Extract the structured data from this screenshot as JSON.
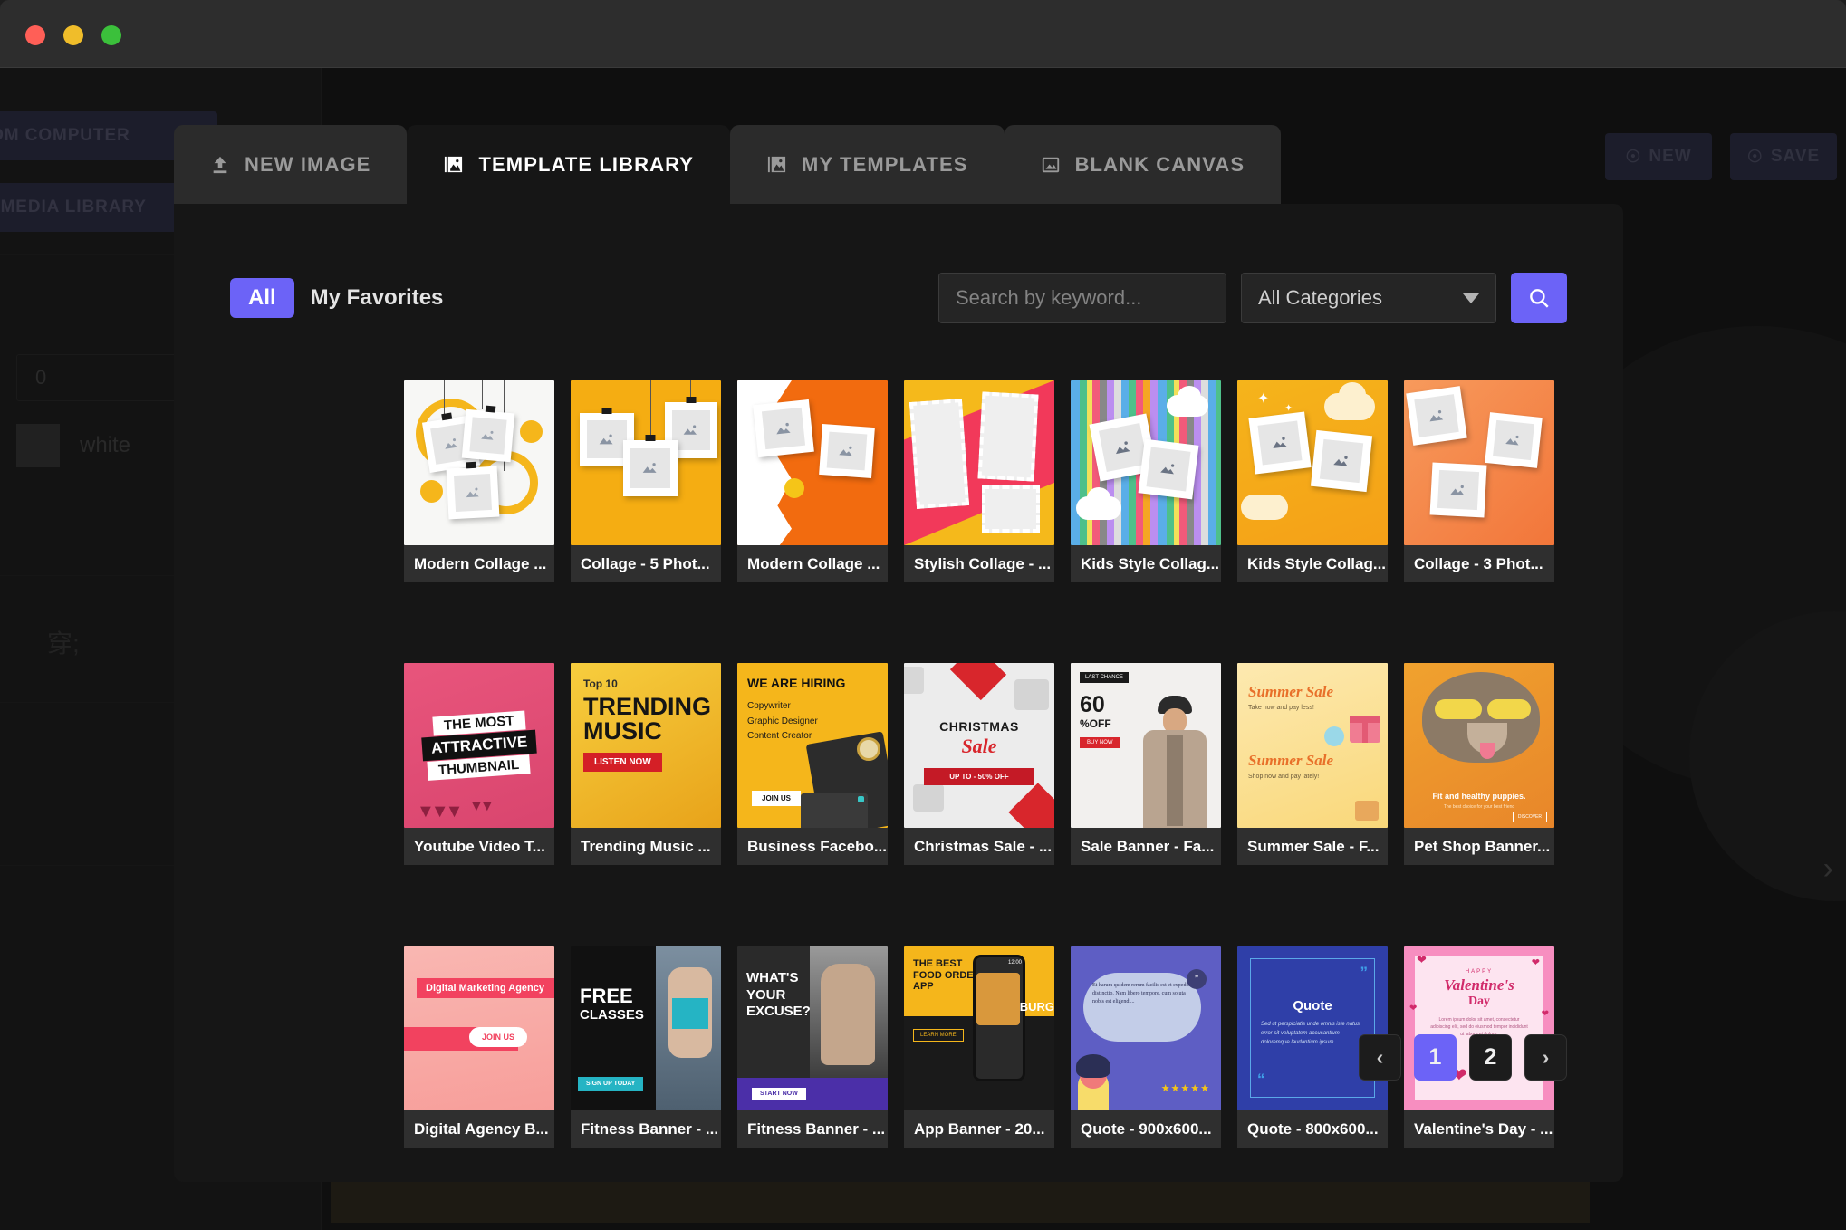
{
  "window": {
    "traffic_lights": [
      "close",
      "minimize",
      "maximize"
    ]
  },
  "background_editor": {
    "left_panel": {
      "upload_from_computer_label": "FROM COMPUTER",
      "upload_from_media_label": "OM MEDIA LIBRARY",
      "number_field_value": "0",
      "color_name": "white",
      "add_icon": "plus-icon"
    },
    "top_right": {
      "new_label": "NEW",
      "save_label": "SAVE"
    }
  },
  "modal": {
    "tabs": [
      {
        "label": "NEW IMAGE",
        "icon": "upload-icon",
        "active": false
      },
      {
        "label": "TEMPLATE LIBRARY",
        "icon": "images-icon",
        "active": true
      },
      {
        "label": "MY TEMPLATES",
        "icon": "images-icon",
        "active": false
      },
      {
        "label": "BLANK CANVAS",
        "icon": "image-icon",
        "active": false
      }
    ],
    "toolbar": {
      "filter_all_label": "All",
      "filter_favorites_label": "My Favorites",
      "search_placeholder": "Search by keyword...",
      "search_value": "",
      "category_selected": "All Categories",
      "search_button_icon": "search-icon",
      "accent_color": "#6c63f7"
    },
    "templates": [
      {
        "label": "Modern Collage ...",
        "art": "collage-white"
      },
      {
        "label": "Collage - 5 Phot...",
        "art": "collage-amber"
      },
      {
        "label": "Modern Collage ...",
        "art": "collage-orange"
      },
      {
        "label": "Stylish Collage - ...",
        "art": "collage-stamps"
      },
      {
        "label": "Kids Style Collag...",
        "art": "collage-stripes"
      },
      {
        "label": "Kids Style Collag...",
        "art": "collage-clouds"
      },
      {
        "label": "Collage - 3 Phot...",
        "art": "collage-peach"
      },
      {
        "label": "Youtube Video T...",
        "art": "youtube-thumb"
      },
      {
        "label": "Trending Music ...",
        "art": "trending-music"
      },
      {
        "label": "Business Facebo...",
        "art": "we-are-hiring"
      },
      {
        "label": "Christmas Sale - ...",
        "art": "christmas-sale"
      },
      {
        "label": "Sale Banner - Fa...",
        "art": "sale-banner"
      },
      {
        "label": "Summer Sale - F...",
        "art": "summer-sale"
      },
      {
        "label": "Pet Shop Banner...",
        "art": "pet-shop"
      },
      {
        "label": "Digital Agency B...",
        "art": "digital-agency"
      },
      {
        "label": "Fitness Banner - ...",
        "art": "free-classes"
      },
      {
        "label": "Fitness Banner - ...",
        "art": "whats-your-excuse"
      },
      {
        "label": "App Banner - 20...",
        "art": "app-banner"
      },
      {
        "label": "Quote - 900x600...",
        "art": "quote-purple"
      },
      {
        "label": "Quote - 800x600...",
        "art": "quote-blue"
      },
      {
        "label": "Valentine's Day - ...",
        "art": "valentines"
      }
    ],
    "thumbnail_text": {
      "youtube_line1": "THE MOST",
      "youtube_line2": "ATTRACTIVE",
      "youtube_line3": "THUMBNAIL",
      "music_badge": "Top 10",
      "music_line1": "TRENDING",
      "music_line2": "MUSIC",
      "music_cta": "LISTEN NOW",
      "hiring_title": "WE ARE HIRING",
      "hiring_item1": "Copywriter",
      "hiring_item2": "Graphic Designer",
      "hiring_item3": "Content Creator",
      "hiring_cta": "JOIN US",
      "christmas_line1": "CHRISTMAS",
      "christmas_line2": "Sale",
      "christmas_cta": "UP TO - 50% OFF",
      "sale_tag": "LAST CHANCE",
      "sale_number": "60",
      "sale_percent": "%OFF",
      "sale_cta": "BUY NOW",
      "summer_line1": "Summer Sale",
      "summer_sub": "Take now and pay less!",
      "summer_line2": "Summer Sale",
      "summer_cta": "Shop now and pay lately!",
      "pet_title": "Fit and healthy puppies.",
      "pet_sub": "The best choice for your best friend",
      "pet_badge": "DISCOVER",
      "agency_title": "Digital Marketing Agency",
      "agency_cta": "JOIN US",
      "fitness_line1": "FREE",
      "fitness_line2": "CLASSES",
      "fitness_cta": "SIGN UP TODAY",
      "excuse_line1": "WHAT'S",
      "excuse_line2": "YOUR",
      "excuse_line3": "EXCUSE?",
      "excuse_cta": "START NOW",
      "app_title": "THE BEST FOOD ORDER APP",
      "app_cta": "LEARN MORE",
      "app_time": "12:00",
      "app_burger": "BURG",
      "quote_purple_text": "Et harum quidem rerum facilis est et expedita distinctio. Nam libero tempore, cum soluta nobis est eligendi...",
      "quote_blue_title": "Quote",
      "quote_blue_text": "Sed ut perspiciatis unde omnis iste natus error sit voluptatem accusantium doloremque laudantium ipsum...",
      "valentines_small": "HAPPY",
      "valentines_line1": "Valentine's",
      "valentines_line2": "Day",
      "valentines_text": "Lorem ipsum dolor sit amet, consectetur adipiscing elit, sed do eiusmod tempor incididunt ut labore et dolore."
    },
    "pagination": {
      "prev_icon": "chevron-left-icon",
      "next_icon": "chevron-right-icon",
      "pages": [
        "1",
        "2"
      ],
      "current_page": "1"
    }
  }
}
